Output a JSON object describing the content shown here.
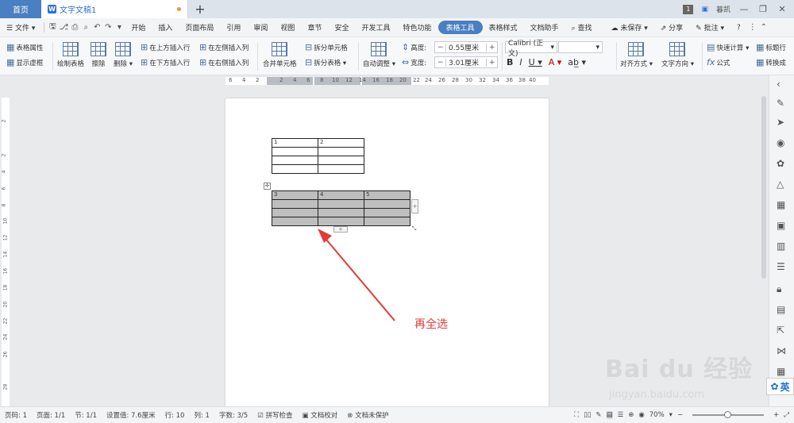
{
  "titlebar": {
    "home_tab": "首页",
    "doc_tab": "文字文稿1",
    "doc_icon": "W",
    "new_tab": "+",
    "window_count": "1",
    "user": "暮凯"
  },
  "menubar": {
    "file": "文件",
    "items": [
      "开始",
      "插入",
      "页面布局",
      "引用",
      "审阅",
      "视图",
      "章节",
      "安全",
      "开发工具",
      "特色功能",
      "表格工具",
      "表格样式",
      "文档助手"
    ],
    "active": "表格工具",
    "search": "查找",
    "save_status": "未保存",
    "share": "分享",
    "comment": "批注",
    "help": "?"
  },
  "ribbon": {
    "table_props": "表格属性",
    "show_gridlines": "显示虚框",
    "draw_table": "绘制表格",
    "eraser": "擦除",
    "delete": "删除",
    "insert_above": "在上方插入行",
    "insert_below": "在下方插入行",
    "insert_left": "在左侧插入列",
    "insert_right": "在右侧插入列",
    "merge_cells": "合并单元格",
    "split_cells": "拆分单元格",
    "split_table": "拆分表格",
    "autofit": "自动调整",
    "height_label": "高度:",
    "height_value": "0.55厘米",
    "width_label": "宽度:",
    "width_value": "3.01厘米",
    "font_name": "Calibri (正文)",
    "font_size": "",
    "align": "对齐方式",
    "text_dir": "文字方向",
    "quick_calc": "快速计算",
    "formula": "公式",
    "title_row": "标题行",
    "convert": "转换成"
  },
  "hruler_ticks": [
    "6",
    "4",
    "2",
    "2",
    "4",
    "6",
    "8",
    "10",
    "12",
    "14",
    "16",
    "18",
    "20",
    "22",
    "24",
    "26",
    "28",
    "30",
    "32",
    "34",
    "36",
    "38",
    "40"
  ],
  "vruler_ticks": [
    "2",
    "2",
    "4",
    "6",
    "8",
    "10",
    "12",
    "14",
    "16",
    "18",
    "20",
    "22",
    "24",
    "26",
    "28"
  ],
  "table1": {
    "rows": [
      [
        "1",
        "2"
      ],
      [
        "",
        ""
      ],
      [
        "",
        ""
      ],
      [
        "",
        ""
      ]
    ]
  },
  "table2": {
    "rows": [
      [
        "3",
        "4",
        "5"
      ],
      [
        "",
        "",
        ""
      ],
      [
        "",
        "",
        ""
      ],
      [
        "",
        "",
        ""
      ]
    ]
  },
  "annotation": "再全选",
  "statusbar": {
    "page_code": "页码: 1",
    "page": "页面: 1/1",
    "section": "节: 1/1",
    "setting": "设置值: 7.6厘米",
    "row": "行: 10",
    "col": "列: 1",
    "words": "字数: 3/5",
    "spellcheck": "拼写检查",
    "doc_proof": "文档校对",
    "doc_protect": "文档未保护",
    "zoom": "70%"
  },
  "watermark": {
    "main": "Bai du 经验",
    "sub": "jingyan.baidu.com"
  },
  "ime": "英",
  "colors": {
    "accent": "#4a7fc1",
    "selection": "#bebebe",
    "annotation": "#e53935"
  }
}
